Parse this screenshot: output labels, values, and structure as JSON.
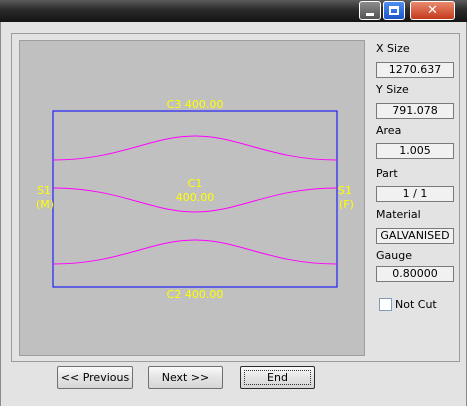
{
  "title_bar": {
    "buttons": [
      "minimize",
      "maximize",
      "close"
    ],
    "close_glyph": "✕"
  },
  "canvas": {
    "background": "#c0c0c0",
    "outline_color": "#0000ff",
    "curve_color": "#ff00ff",
    "label_color": "#ffff00",
    "labels": {
      "top": "C3 400.00",
      "bottom": "C2 400.00",
      "center_id": "C1",
      "center_value": "400.00",
      "left_id": "S1",
      "left_side": "(M)",
      "right_id": "S1",
      "right_side": "(F)"
    }
  },
  "properties": {
    "x_size_label": "X Size",
    "x_size": "1270.637",
    "y_size_label": "Y Size",
    "y_size": "791.078",
    "area_label": "Area",
    "area": "1.005",
    "part_label": "Part",
    "part": "1 / 1",
    "material_label": "Material",
    "material": "GALVANISED",
    "gauge_label": "Gauge",
    "gauge": "0.80000",
    "not_cut_label": "Not Cut",
    "not_cut_checked": false
  },
  "buttons": {
    "previous": "<< Previous",
    "next": "Next >>",
    "end": "End"
  }
}
